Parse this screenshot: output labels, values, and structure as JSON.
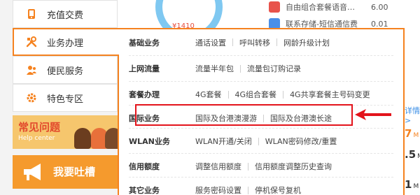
{
  "sidebar": {
    "items": [
      {
        "label": "充值交费",
        "icon": "phone-recharge-icon"
      },
      {
        "label": "业务办理",
        "icon": "tools-icon",
        "active": true
      },
      {
        "label": "便民服务",
        "icon": "people-icon"
      },
      {
        "label": "特色专区",
        "icon": "gear-icon"
      }
    ],
    "help_banner": {
      "title": "常见问题",
      "subtitle": "Help center"
    },
    "complain_banner": {
      "title": "我要吐槽",
      "icon": "megaphone-icon"
    }
  },
  "background": {
    "gauge_value": "¥1410",
    "rows": [
      {
        "label": "自由组合套餐语音…",
        "price": "6.00",
        "icon": "paperclip-icon"
      },
      {
        "label": "联系存储-短信通信费",
        "price": "0.01",
        "icon": "tag-icon"
      }
    ],
    "more_link": "详情>",
    "numbers": [
      {
        "value": "7",
        "unit": "M"
      },
      {
        "value": ".5",
        "unit": "M"
      },
      {
        "value": "1",
        "unit": "M"
      }
    ]
  },
  "flyout": {
    "rows": [
      {
        "category": "基础业务",
        "links": [
          "通话设置",
          "呼叫转移",
          "网龄升级计划"
        ]
      },
      {
        "category": "上网流量",
        "links": [
          "流量半年包",
          "流量包订购记录"
        ]
      },
      {
        "category": "套餐办理",
        "links": [
          "4G套餐",
          "4G组合套餐",
          "4G共享套餐主号码变更"
        ]
      },
      {
        "category": "国际业务",
        "links": [
          "国际及台港澳漫游",
          "国际及台港澳长途"
        ]
      },
      {
        "category": "WLAN业务",
        "links": [
          "WLAN开通/关闭",
          "WLAN密码修改/重置"
        ]
      },
      {
        "category": "信用额度",
        "links": [
          "调整信用额度",
          "信用额度调整历史查询"
        ]
      },
      {
        "category": "其它业务",
        "links": [
          "服务密码设置",
          "停机保号复机"
        ]
      }
    ]
  },
  "annotation": {
    "color": "#e3131b",
    "highlighted_category": "国际业务"
  },
  "colors": {
    "accent": "#f5821f",
    "highlight": "#e3131b",
    "link_blue": "#3a8ee6"
  }
}
